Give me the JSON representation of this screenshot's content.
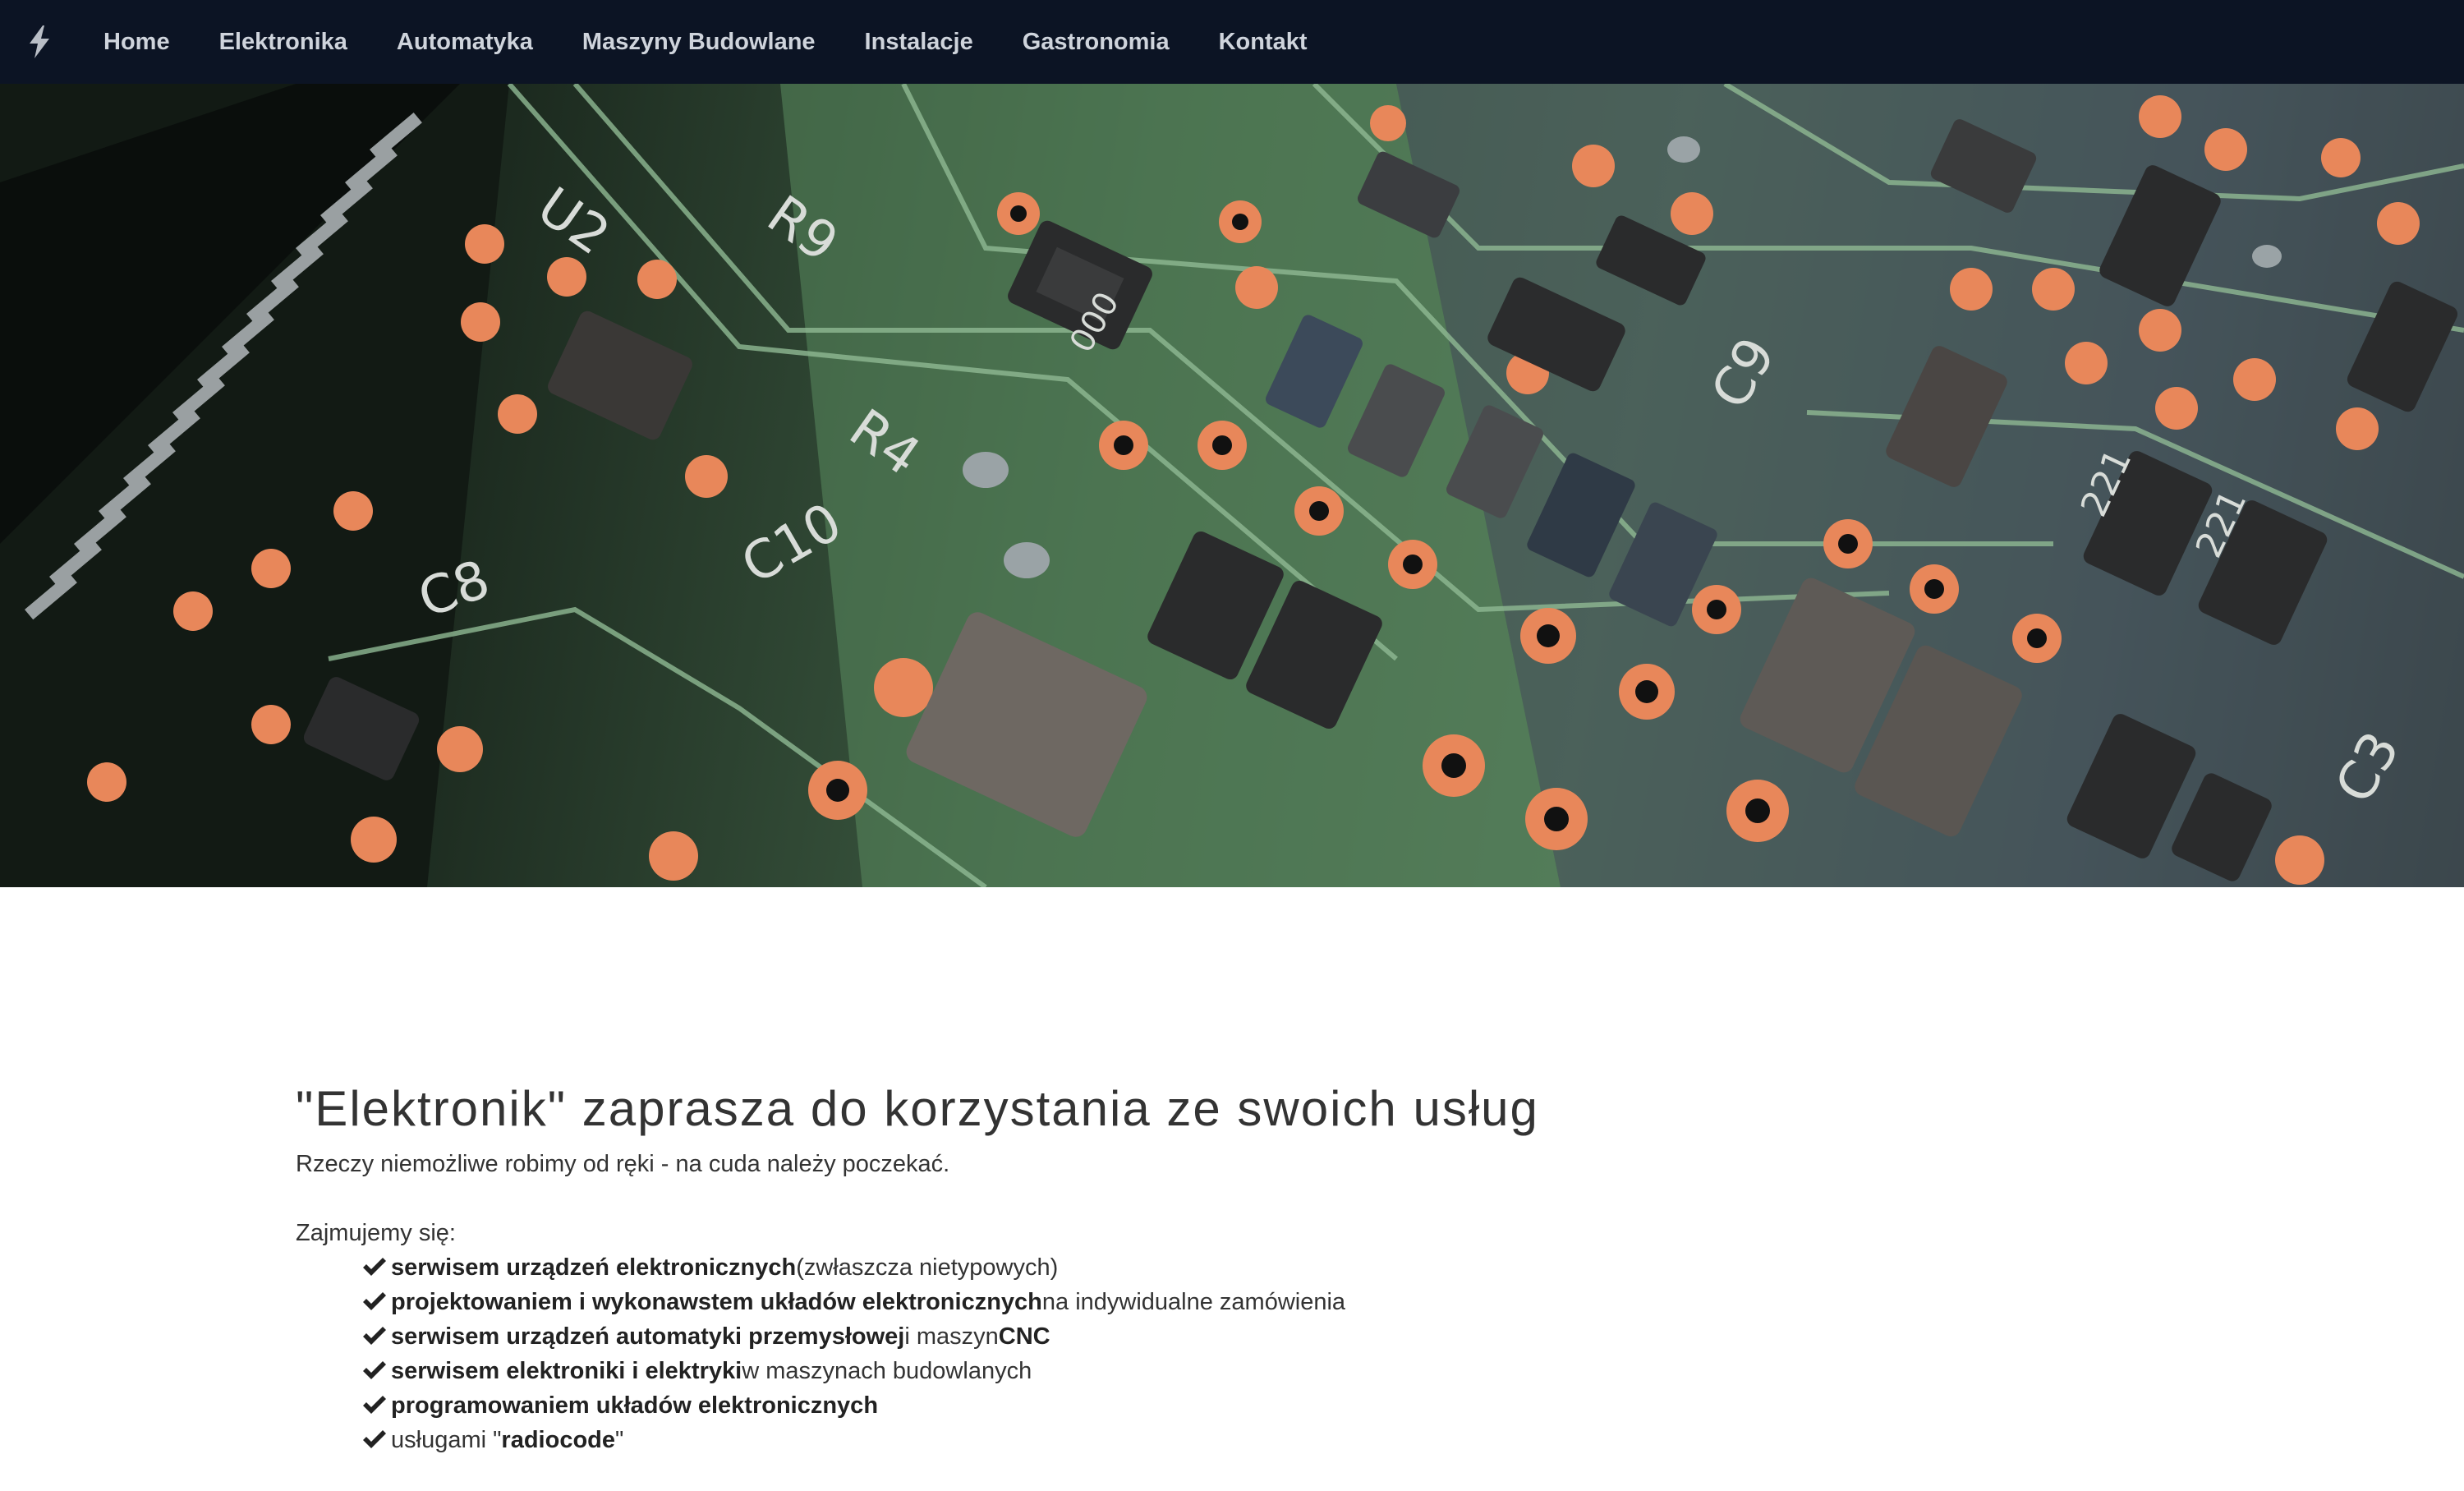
{
  "nav": {
    "brand_icon": "lightning-bolt-icon",
    "items": [
      {
        "label": "Home"
      },
      {
        "label": "Elektronika"
      },
      {
        "label": "Automatyka"
      },
      {
        "label": "Maszyny Budowlane"
      },
      {
        "label": "Instalacje"
      },
      {
        "label": "Gastronomia"
      },
      {
        "label": "Kontakt"
      }
    ]
  },
  "hero": {
    "image": "circuit-board-photo",
    "silk_labels": [
      "U2",
      "R9",
      "R4",
      "C10",
      "C8",
      "C9",
      "221",
      "221",
      "C3",
      "000"
    ]
  },
  "content": {
    "headline": "\"Elektronik\" zaprasza do korzystania ze swoich usług",
    "tagline": "Rzeczy niemożliwe robimy od ręki - na cuda należy poczekać.",
    "intro": "Zajmujemy się:",
    "services": [
      {
        "bold": "serwisem urządzeń elektronicznych",
        "rest": " (zwłaszcza nietypowych)",
        "bold2": "",
        "rest2": ""
      },
      {
        "bold": "projektowaniem i wykonawstem układów elektronicznych",
        "rest": " na indywidualne zamówienia",
        "bold2": "",
        "rest2": ""
      },
      {
        "bold": "serwisem urządzeń automatyki przemysłowej",
        "rest": " i maszyn ",
        "bold2": "CNC",
        "rest2": ""
      },
      {
        "bold": "serwisem elektroniki i elektryki",
        "rest": " w maszynach budowlanych",
        "bold2": "",
        "rest2": ""
      },
      {
        "bold": "programowaniem układów elektronicznych",
        "rest": "",
        "bold2": "",
        "rest2": ""
      },
      {
        "bold": "",
        "rest": "usługami \"",
        "bold2": "radiocode",
        "rest2": "\""
      }
    ]
  },
  "colors": {
    "navbar_bg": "#0c1424",
    "nav_text": "#cfd4dc",
    "body_text": "#333333",
    "pad_copper": "#e8875a",
    "pcb_green": "#4f7a55"
  }
}
